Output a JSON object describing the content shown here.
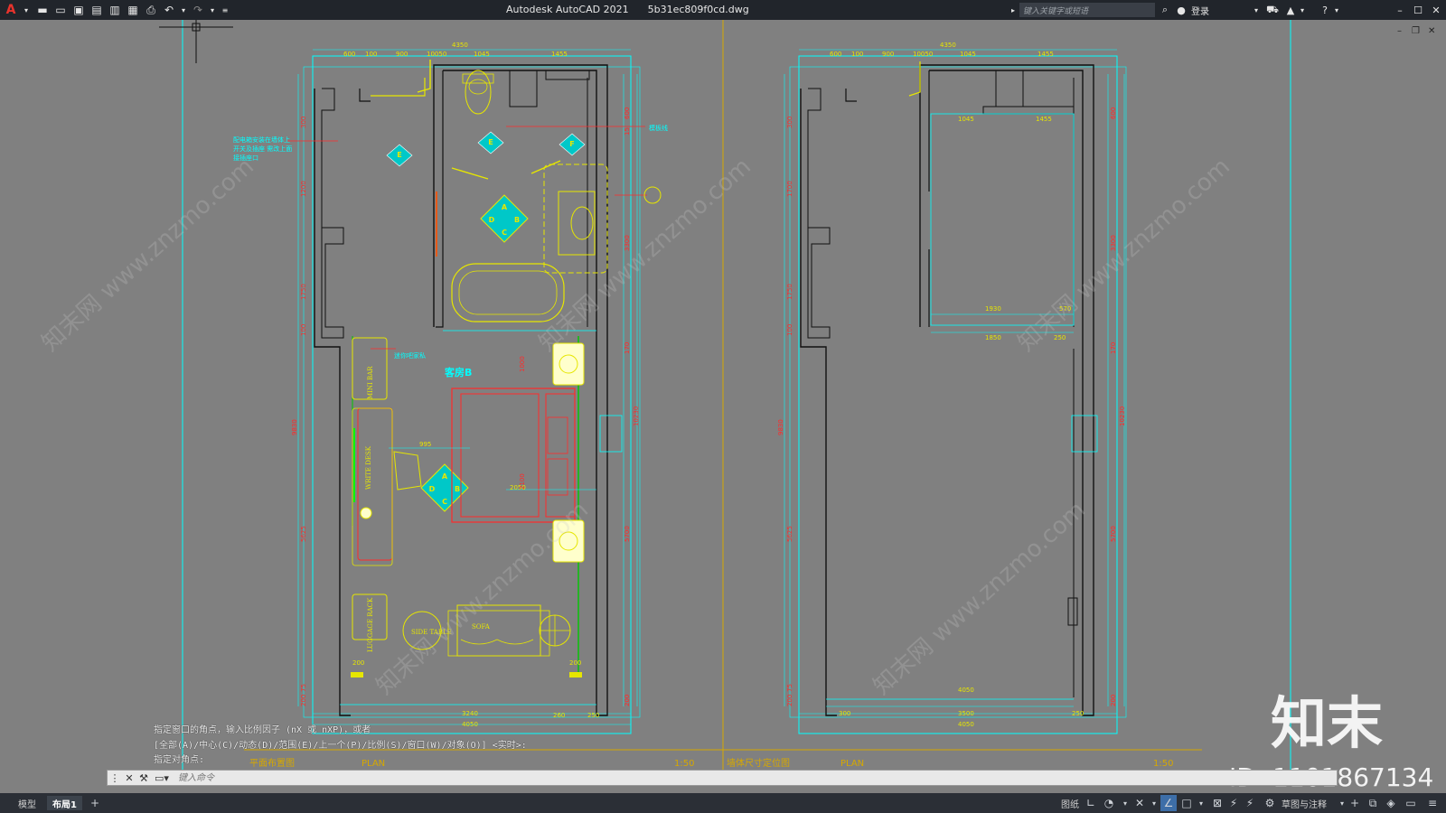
{
  "app": {
    "title": "Autodesk AutoCAD 2021",
    "filename": "5b31ec809f0cd.dwg",
    "search_placeholder": "键入关键字或短语",
    "login_label": "登录"
  },
  "drawing": {
    "left_plan": {
      "dims_top": [
        "4350",
        "600",
        "100",
        "900",
        "10050",
        "1045",
        "1455"
      ],
      "dims_left": [
        "300",
        "1200",
        "1750",
        "100",
        "9830",
        "5625",
        "200",
        "75"
      ],
      "dims_right": [
        "600",
        "15",
        "3300",
        "170",
        "10230",
        "5700",
        "200"
      ],
      "dims_bottom": [
        "3240",
        "4050",
        "260",
        "250",
        "200",
        "200"
      ],
      "room_label": "客房B",
      "note_left": "配电箱安装在墙体上 开关及插座 需改上面接插座口",
      "note_right": "模板线",
      "note_minibar": "迷你吧家私",
      "furniture": [
        "MINI BAR",
        "WRITE DESK",
        "LUGGAGE RACK",
        "SIDE TABLE",
        "SOFA"
      ],
      "dim_995": "995",
      "dim_2100": "2100",
      "dim_2050": "2050",
      "dim_1000": "1000"
    },
    "right_plan": {
      "dims_top": [
        "4350",
        "600",
        "100",
        "900",
        "10050",
        "1045",
        "1455"
      ],
      "dims_inner": [
        "1045",
        "1455",
        "1930",
        "570",
        "1850",
        "250"
      ],
      "dims_left": [
        "300",
        "1700",
        "1750",
        "100",
        "9830",
        "5625",
        "200",
        "75"
      ],
      "dims_right": [
        "600",
        "3300",
        "170",
        "10230",
        "5700",
        "200"
      ],
      "dims_bottom": [
        "4050",
        "3500",
        "4050",
        "300",
        "250"
      ]
    },
    "layout_labels": [
      "平面布置图",
      "PLAN",
      "1:50",
      "墙体尺寸定位图",
      "PLAN",
      "1:50"
    ]
  },
  "command": {
    "history": [
      "指定窗口的角点，输入比例因子 (nX 或 nXP)，或者",
      "[全部(A)/中心(C)/动态(D)/范围(E)/上一个(P)/比例(S)/窗口(W)/对象(O)] <实时>:",
      "指定对角点:"
    ],
    "placeholder": "键入命令"
  },
  "status": {
    "tabs": [
      "模型",
      "布局1"
    ],
    "active_tab": "布局1",
    "paper_label": "图纸",
    "workspace_label": "草图与注释"
  },
  "watermark": {
    "brand": "知末",
    "id": "ID: 1101867134",
    "site": "知末网 www.znzmo.com"
  },
  "colors": {
    "canvas_bg": "#808080",
    "titlebar_bg": "#21252b",
    "cyan": "#00ffff",
    "yellow": "#e6e600",
    "red": "#ff2a2a",
    "green": "#00ff00"
  }
}
